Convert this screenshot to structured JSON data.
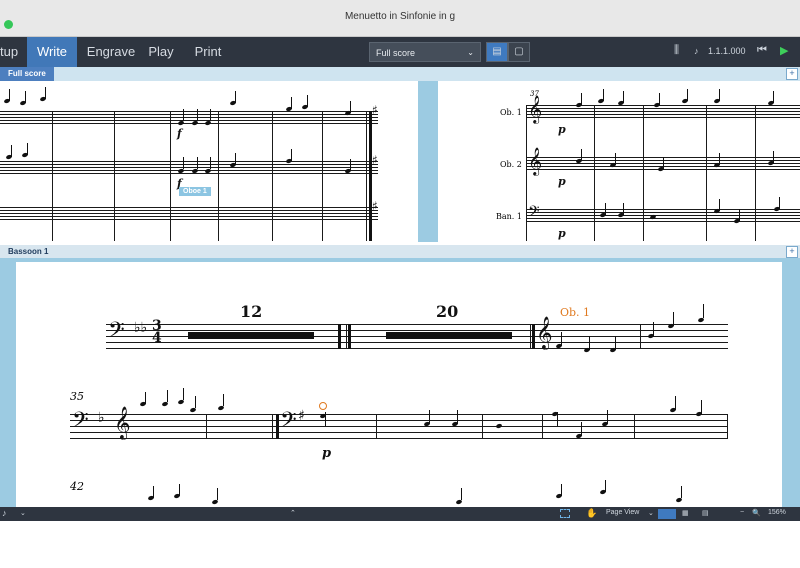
{
  "window": {
    "title": "Menuetto in Sinfonie in g"
  },
  "toolbar": {
    "modes": [
      "tup",
      "Write",
      "Engrave",
      "Play",
      "Print"
    ],
    "active_mode": "Write",
    "layout_select": "Full score",
    "position": "1.1.1.000"
  },
  "full_score": {
    "tab": "Full score",
    "left_page_label": {
      "text": "Oboe 1"
    },
    "right_page": {
      "bar_number": "37",
      "instruments": [
        "Ob. 1",
        "Ob. 2",
        "Ban. 1"
      ],
      "dynamics": [
        "p",
        "p",
        "p"
      ]
    },
    "left_dynamics": [
      "f",
      "f"
    ]
  },
  "part": {
    "tab": "Bassoon 1",
    "multirests": [
      "12",
      "20"
    ],
    "cue_label": "Ob. 1",
    "system_numbers": [
      "35",
      "42"
    ],
    "dynamic": "p"
  },
  "statusbar": {
    "view": "Page View",
    "zoom": "156%"
  },
  "colors": {
    "accent": "#4178b8",
    "cue": "#e07a20",
    "toolbar": "#2e3540",
    "gap": "#9ccbe2"
  },
  "icons": [
    "close-window-icon",
    "mixer-icon",
    "transport-rewind-icon",
    "play-icon",
    "select-icon",
    "hand-icon",
    "zoom-out-icon",
    "zoom-in-icon"
  ]
}
